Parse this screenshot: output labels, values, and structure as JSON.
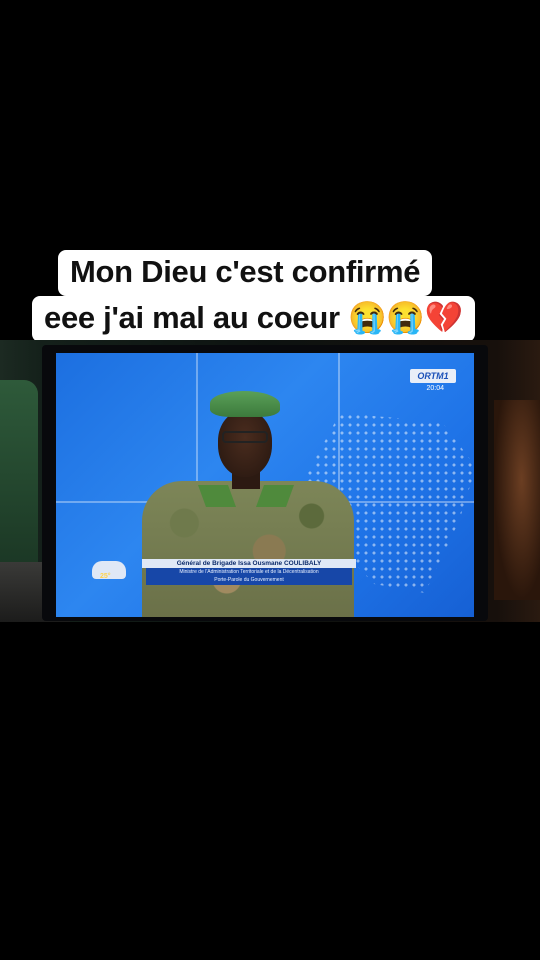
{
  "caption": {
    "line1": "Mon Dieu c'est confirmé",
    "line2": "eee j'ai mal au coeur 😭😭💔"
  },
  "tv": {
    "channel_logo": "ORTM1",
    "clock": "20:04",
    "lower_third": {
      "name": "Général de Brigade Issa Ousmane COULIBALY",
      "title_line1": "Ministre de l'Administration Territoriale et de la Décentralisation",
      "title_line2": "Porte-Parole du Gouvernement"
    },
    "weather_temp": "25°"
  }
}
